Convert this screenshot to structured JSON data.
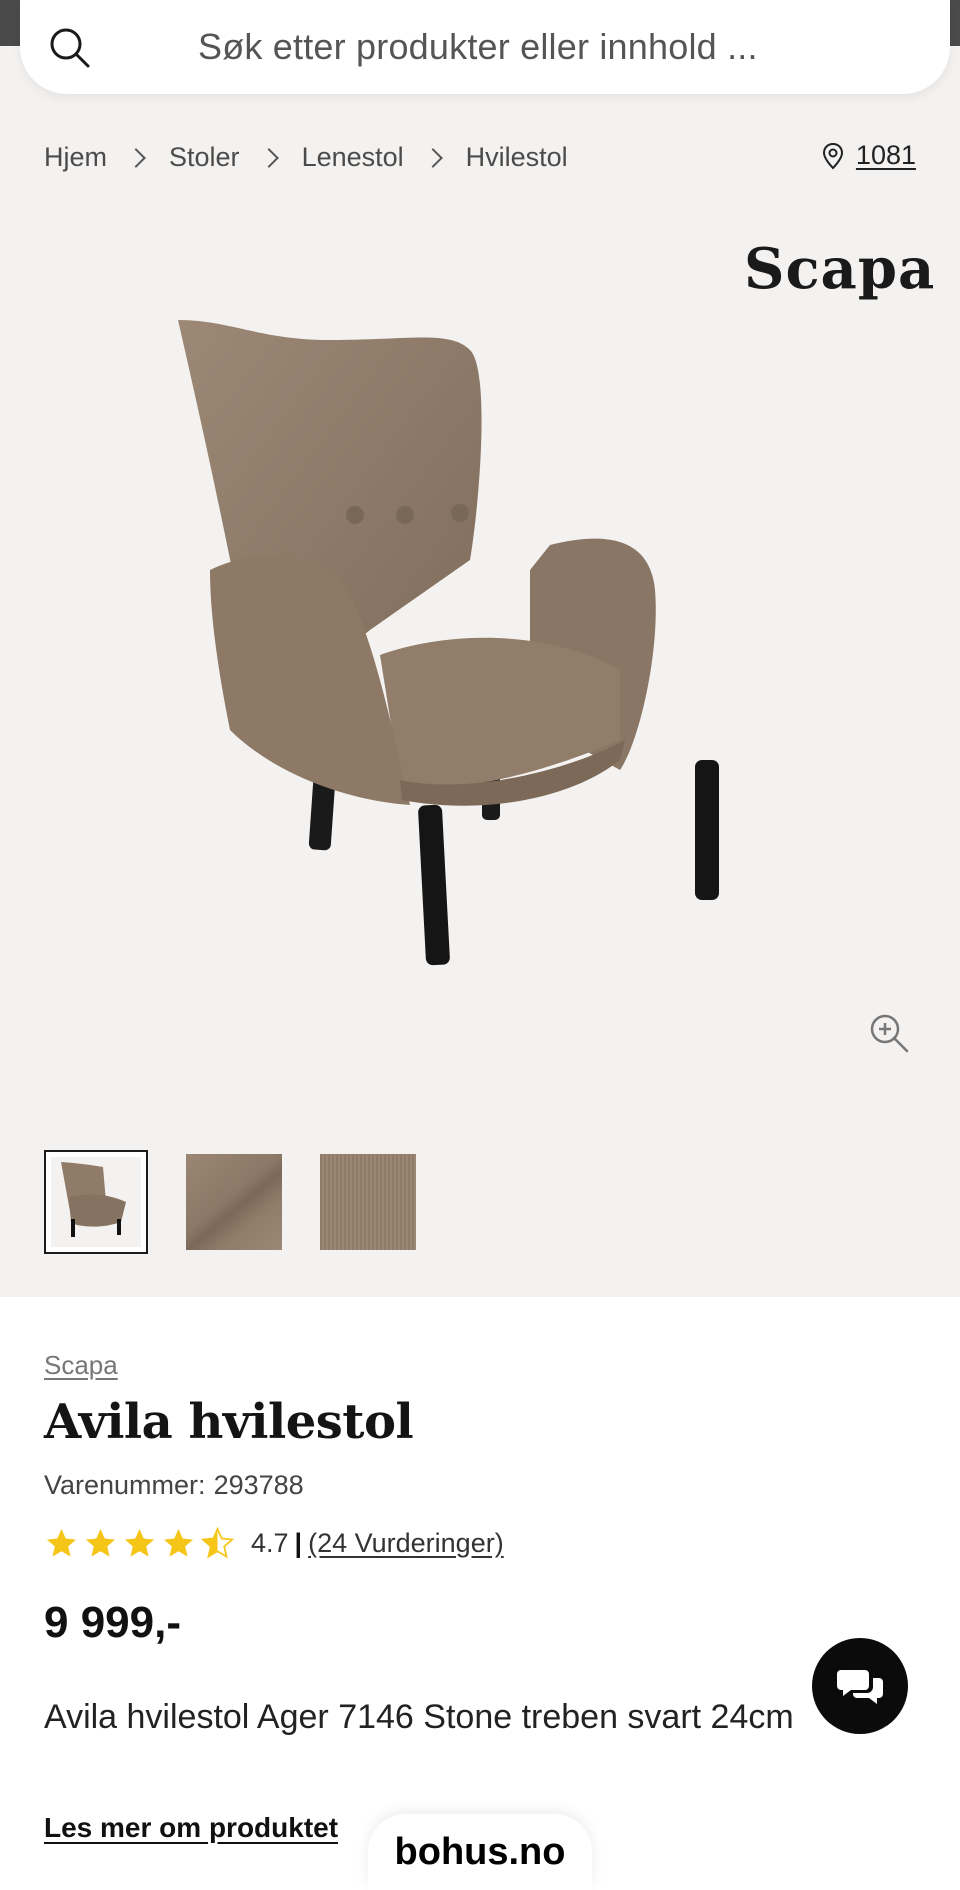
{
  "search": {
    "placeholder": "Søk etter produkter eller innhold ...",
    "icon": "search-icon"
  },
  "breadcrumb": [
    "Hjem",
    "Stoler",
    "Lenestol",
    "Hvilestol"
  ],
  "store": {
    "label": "1081",
    "icon": "location-pin-icon"
  },
  "gallery": {
    "brand_logo": "Scapa",
    "thumbnails": [
      "chair",
      "fabric-closeup",
      "fabric-texture"
    ],
    "active_thumbnail": 0,
    "zoom_icon": "zoom-in-icon"
  },
  "product": {
    "brand": "Scapa",
    "title": "Avila hvilestol",
    "sku_label": "Varenummer:",
    "sku": "293788",
    "rating": "4.7",
    "rating_separator": "|",
    "reviews": "(24 Vurderinger)",
    "price": "9 999,-",
    "description": "Avila hvilestol Ager 7146 Stone treben svart 24cm",
    "read_more": "Les mer om produktet"
  },
  "footer": {
    "domain": "bohus.no",
    "chat_icon": "chat-icon"
  },
  "colors": {
    "star": "#f5c518",
    "chair_fabric": "#8f7b68",
    "page_bg": "#f4f2f0"
  }
}
